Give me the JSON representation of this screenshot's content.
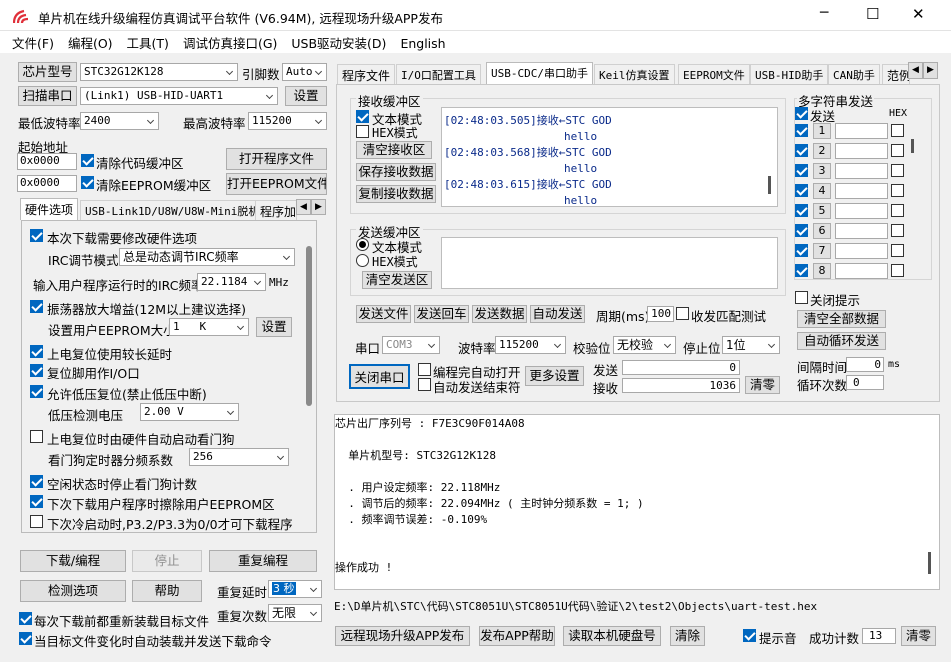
{
  "window": {
    "title": "单片机在线升级编程仿真调试平台软件 (V6.94M), 远程现场升级APP发布",
    "minimize": "─",
    "maximize": "☐",
    "close": "✕"
  },
  "menu": [
    "文件(F)",
    "编程(O)",
    "工具(T)",
    "调试仿真接口(G)",
    "USB驱动安装(D)",
    "English"
  ],
  "left": {
    "chip_btn": "芯片型号",
    "chip_value": "STC32G12K128",
    "pin_label": "引脚数",
    "pin_value": "Auto",
    "scan_btn": "扫描串口",
    "port_value": "(Link1) USB-HID-UART1",
    "settings_btn": "设置",
    "min_baud_label": "最低波特率",
    "min_baud": "2400",
    "max_baud_label": "最高波特率",
    "max_baud": "115200",
    "start_addr_label": "起始地址",
    "addr1": "0x0000",
    "clear_code_label": "清除代码缓冲区",
    "open_prog_btn": "打开程序文件",
    "addr2": "0x0000",
    "clear_eeprom_label": "清除EEPROM缓冲区",
    "open_eeprom_btn": "打开EEPROM文件",
    "tabs": [
      "硬件选项",
      "USB-Link1D/U8W/U8W-Mini脱机",
      "程序加"
    ],
    "hw": {
      "opt1": "本次下载需要修改硬件选项",
      "irc_mode_label": "IRC调节模式",
      "irc_mode": "总是动态调节IRC频率",
      "irc_freq_label": "输入用户程序运行时的IRC频率",
      "irc_freq": "22.1184",
      "mhz": "MHz",
      "opt2": "振荡器放大增益(12M以上建议选择)",
      "eeprom_size_label": "设置用户EEPROM大小",
      "eeprom_size": "1   K",
      "eeprom_set_btn": "设置",
      "opt3": "上电复位使用较长延时",
      "opt4": "复位脚用作I/O口",
      "opt5": "允许低压复位(禁止低压中断)",
      "lv_label": "低压检测电压",
      "lv_value": "2.00 V",
      "opt6": "上电复位时由硬件自动启动看门狗",
      "wdt_label": "看门狗定时器分频系数",
      "wdt_value": "256",
      "opt7": "空闲状态时停止看门狗计数",
      "opt8": "下次下载用户程序时擦除用户EEPROM区",
      "opt9": "下次冷启动时,P3.2/P3.3为0/0才可下载程序"
    },
    "download_btn": "下载/编程",
    "stop_btn": "停止",
    "redo_btn": "重复编程",
    "check_btn": "检测选项",
    "help_btn": "帮助",
    "repeat_delay_label": "重复延时",
    "repeat_delay": "3 秒",
    "repeat_count_label": "重复次数",
    "repeat_count": "无限",
    "reload_label": "每次下载前都重新装载目标文件",
    "auto_label": "当目标文件变化时自动装载并发送下载命令"
  },
  "tabs": [
    "程序文件",
    "I/O口配置工具",
    "USB-CDC/串口助手",
    "Keil仿真设置",
    "EEPROM文件",
    "USB-HID助手",
    "CAN助手",
    "范例"
  ],
  "serial": {
    "recv_title": "接收缓冲区",
    "text_mode": "文本模式",
    "hex_mode": "HEX模式",
    "clear_recv_btn": "清空接收区",
    "save_recv_btn": "保存接收数据",
    "copy_recv_btn": "复制接收数据",
    "recv_lines": [
      {
        "time": "[02:48:03.505]接收←STC GOD",
        "data": "hello"
      },
      {
        "time": "[02:48:03.568]接收←STC GOD",
        "data": "hello"
      },
      {
        "time": "[02:48:03.615]接收←STC GOD",
        "data": "hello"
      }
    ],
    "send_title": "发送缓冲区",
    "send_text_mode": "文本模式",
    "send_hex_mode": "HEX模式",
    "clear_send_btn": "清空发送区",
    "send_file_btn": "发送文件",
    "send_return_btn": "发送回车",
    "send_data_btn": "发送数据",
    "auto_send_btn": "自动发送",
    "period_label": "周期(ms)",
    "period": "100",
    "match_label": "收发匹配测试",
    "port_label": "串口",
    "port": "COM3",
    "baud_label": "波特率",
    "baud": "115200",
    "parity_label": "校验位",
    "parity": "无校验",
    "stop_label": "停止位",
    "stop": "1位",
    "close_port_btn": "关闭串口",
    "auto_open_label": "编程完自动打开",
    "auto_end_label": "自动发送结束符",
    "more_btn": "更多设置",
    "send_count_label": "发送",
    "send_count": "0",
    "recv_count_label": "接收",
    "recv_count": "1036",
    "clear_count_btn": "清零"
  },
  "multi": {
    "title": "多字符串发送",
    "send_label": "发送",
    "hex_label": "HEX",
    "rows": [
      "1",
      "2",
      "3",
      "4",
      "5",
      "6",
      "7",
      "8"
    ],
    "close_tip_label": "关闭提示",
    "clear_all_btn": "清空全部数据",
    "auto_loop_btn": "自动循环发送",
    "interval_label": "间隔时间",
    "interval": "0",
    "ms": "ms",
    "loop_label": "循环次数",
    "loop": "0"
  },
  "log": {
    "lines": [
      "芯片出厂序列号 : F7E3C90F014A08",
      "",
      "  单片机型号: STC32G12K128",
      "",
      "  . 用户设定频率: 22.118MHz",
      "  . 调节后的频率: 22.094MHz ( 主时钟分频系数 = 1; )",
      "  . 频率调节误差: -0.109%",
      "",
      "",
      "操作成功 !"
    ],
    "path": "E:\\D单片机\\STC\\代码\\STC8051U\\STC8051U代码\\验证\\2\\test2\\Objects\\uart-test.hex"
  },
  "bottom": {
    "publish_btn": "远程现场升级APP发布",
    "app_help_btn": "发布APP帮助",
    "read_disk_btn": "读取本机硬盘号",
    "clear_btn": "清除",
    "beep_label": "提示音",
    "success_label": "成功计数",
    "success_count": "13",
    "clear_count_btn": "清零"
  }
}
